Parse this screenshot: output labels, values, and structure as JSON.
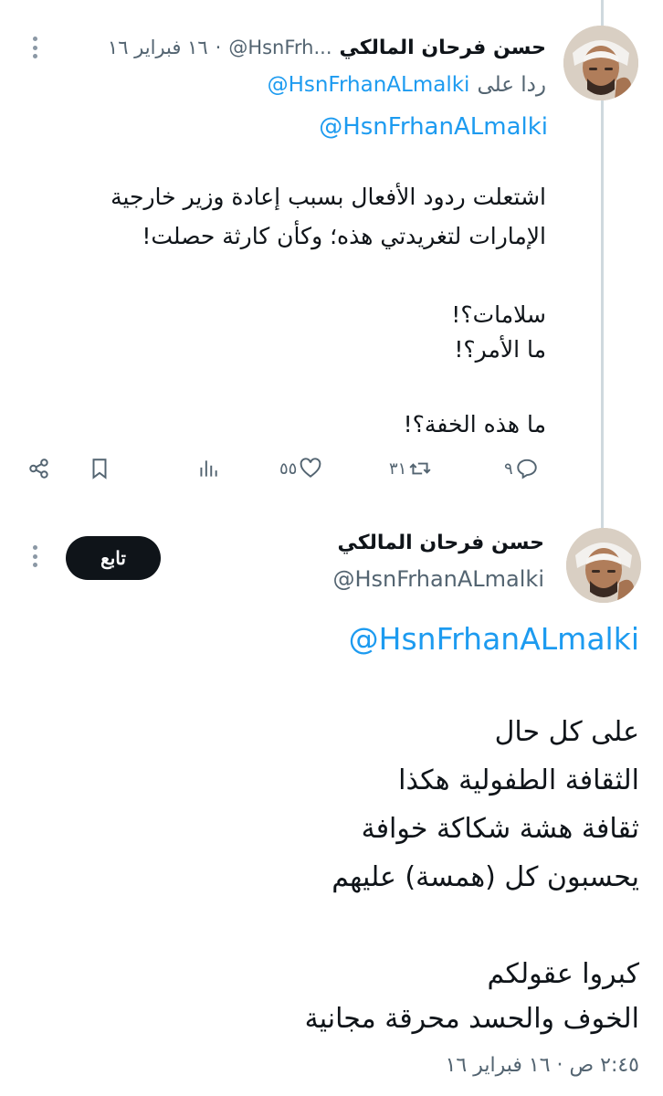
{
  "tweet1": {
    "author_name": "حسن فرحان المالكي",
    "handle_truncated": "@HsnFrh...",
    "separator": "·",
    "date": "١٦ فبراير ١٦",
    "reply_prefix": "ردا على",
    "reply_to": "@HsnFrhanALmalki",
    "mention": "@HsnFrhanALmalki",
    "lines": [
      "اشتعلت ردود الأفعال بسبب إعادة وزير خارجية",
      "الإمارات لتغريدتي هذه؛ وكأن كارثة حصلت!",
      "",
      "سلامات؟!",
      "ما الأمر؟!",
      "",
      "ما هذه الخفة؟!"
    ],
    "actions": {
      "replies": "٩",
      "retweets": "٣١",
      "likes": "٥٥",
      "views": ""
    }
  },
  "tweet2": {
    "author_name": "حسن فرحان المالكي",
    "handle": "@HsnFrhanALmalki",
    "follow_label": "تابع",
    "mention": "@HsnFrhanALmalki",
    "lines": [
      "على كل حال",
      "الثقافة الطفولية هكذا",
      "ثقافة هشة شكاكة خوافة",
      "يحسبون كل (همسة) عليهم",
      "",
      "كبروا عقولكم",
      "الخوف والحسد محرقة مجانية"
    ],
    "timestamp": "٢:٤٥ ص · ١٦ فبراير ١٦"
  },
  "icons": {
    "reply": "reply-icon",
    "retweet": "retweet-icon",
    "like": "heart-icon",
    "views": "bar-chart-icon",
    "bookmark": "bookmark-icon",
    "share": "share-icon",
    "more": "more-vertical-icon"
  },
  "colors": {
    "link": "#1d9bf0",
    "muted": "#536471",
    "text": "#0f1419",
    "follow_bg": "#0f1419"
  }
}
